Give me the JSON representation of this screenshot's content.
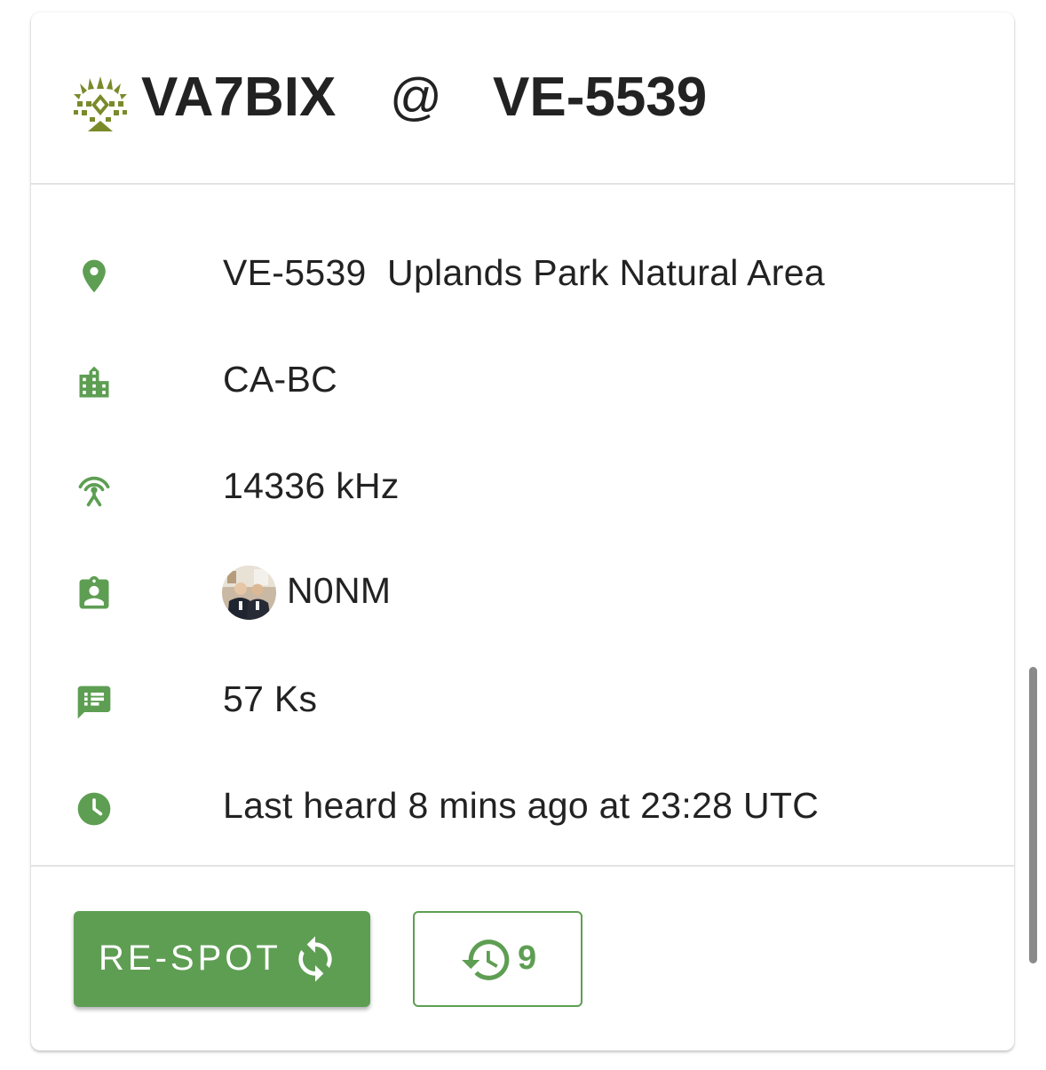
{
  "header": {
    "activator": "VA7BIX",
    "at_sign": "@",
    "park_reference": "VE-5539"
  },
  "details": {
    "park": "VE-5539  Uplands Park Natural Area",
    "location": "CA-BC",
    "frequency": "14336 kHz",
    "spotter": "N0NM",
    "comment": "57 Ks",
    "last_heard": "Last heard 8 mins ago at 23:28 UTC"
  },
  "actions": {
    "respot_label": "RE-SPOT",
    "history_count": "9"
  },
  "icons": {
    "park": "map-pin-icon",
    "location": "building-icon",
    "frequency": "antenna-icon",
    "spotter": "badge-icon",
    "comment": "comment-icon",
    "last_heard": "clock-icon",
    "respot": "refresh-icon",
    "history": "history-icon"
  },
  "colors": {
    "accent": "#5e9e53",
    "logo": "#7a8a2a",
    "text": "#222222",
    "divider": "#e3e3e3"
  }
}
